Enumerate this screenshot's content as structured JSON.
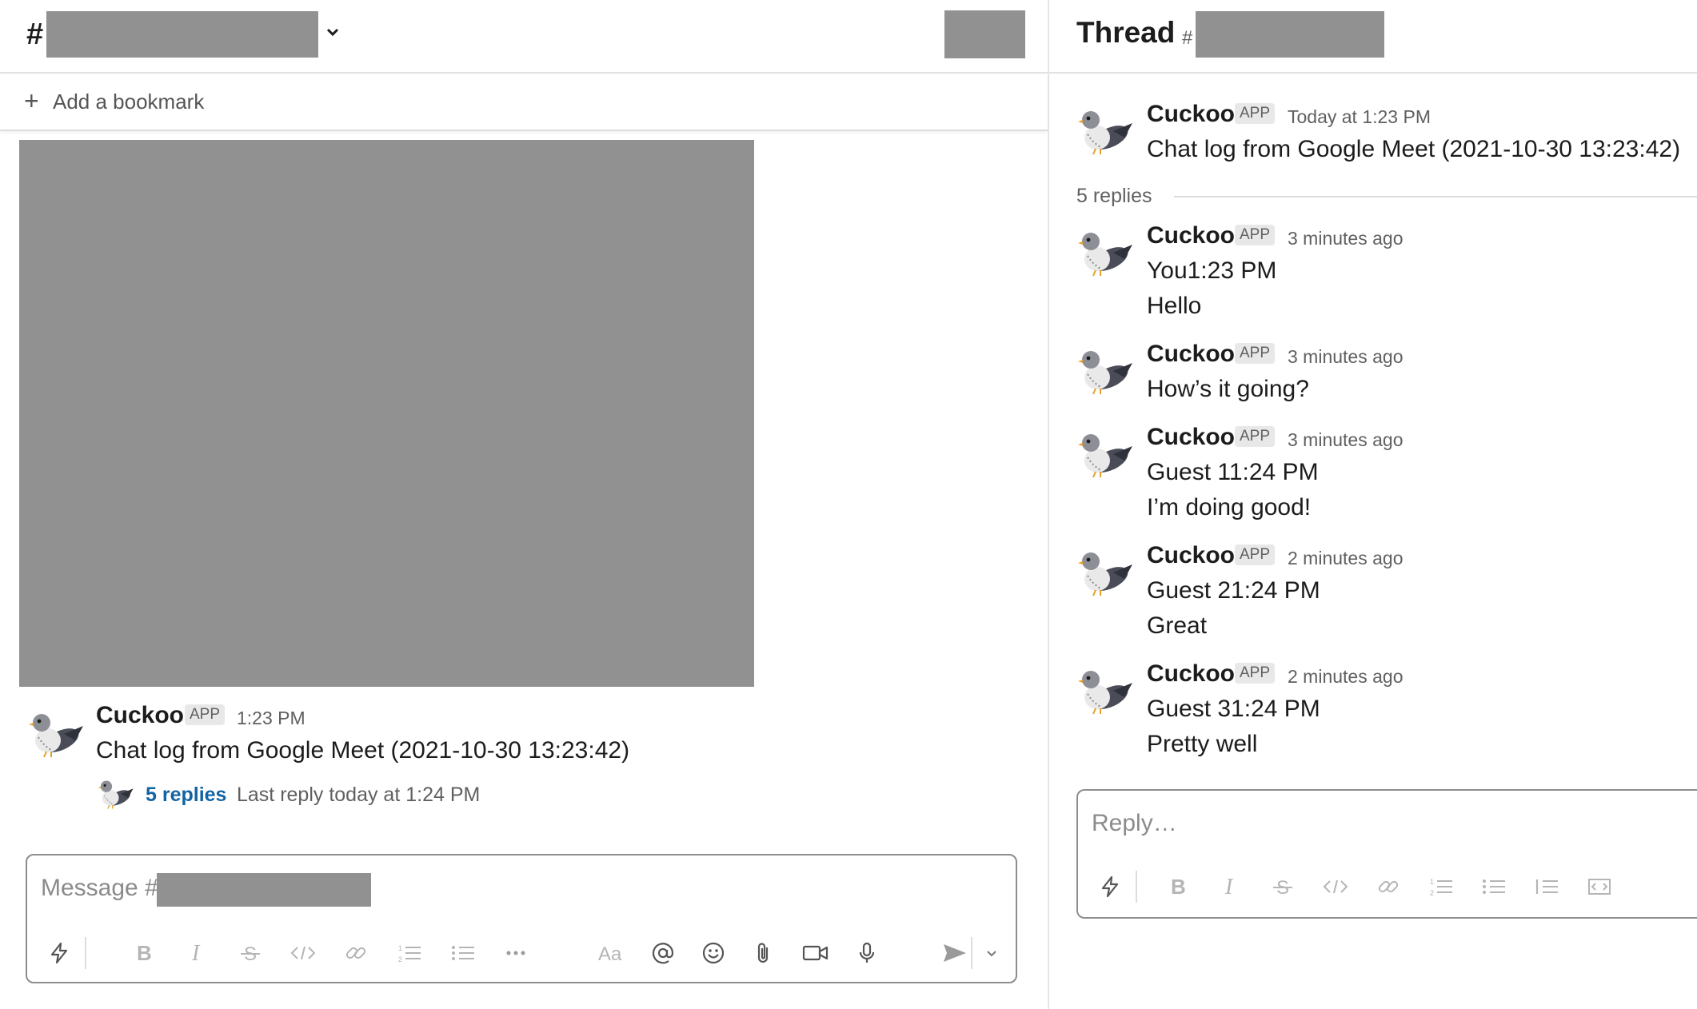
{
  "channel": {
    "hash": "#",
    "bookmark_label": "Add a bookmark",
    "message": {
      "author": "Cuckoo",
      "badge": "APP",
      "time": "1:23 PM",
      "text": "Chat log from Google Meet (2021-10-30 13:23:42)",
      "replies_link": "5 replies",
      "last_reply": "Last reply today at 1:24 PM"
    },
    "composer": {
      "placeholder": "Message #",
      "toolbar_icons": [
        "shortcuts-icon",
        "bold-icon",
        "italic-icon",
        "strikethrough-icon",
        "code-icon",
        "link-icon",
        "ordered-list-icon",
        "bulleted-list-icon",
        "more-icon",
        "formatting-icon",
        "mention-icon",
        "emoji-icon",
        "attach-icon",
        "video-icon",
        "microphone-icon",
        "send-icon",
        "send-options-chevron-icon"
      ]
    }
  },
  "thread": {
    "title": "Thread",
    "hash": "#",
    "parent": {
      "author": "Cuckoo",
      "badge": "APP",
      "time": "Today at 1:23 PM",
      "text": "Chat log from Google Meet (2021-10-30 13:23:42)"
    },
    "replies_count": "5 replies",
    "replies": [
      {
        "author": "Cuckoo",
        "badge": "APP",
        "time": "3 minutes ago",
        "lines": [
          "You1:23 PM",
          "Hello"
        ]
      },
      {
        "author": "Cuckoo",
        "badge": "APP",
        "time": "3 minutes ago",
        "lines": [
          "How’s it going?"
        ]
      },
      {
        "author": "Cuckoo",
        "badge": "APP",
        "time": "3 minutes ago",
        "lines": [
          "Guest 11:24 PM",
          "I’m doing good!"
        ]
      },
      {
        "author": "Cuckoo",
        "badge": "APP",
        "time": "2 minutes ago",
        "lines": [
          "Guest 21:24 PM",
          "Great"
        ]
      },
      {
        "author": "Cuckoo",
        "badge": "APP",
        "time": "2 minutes ago",
        "lines": [
          "Guest 31:24 PM",
          "Pretty well"
        ]
      }
    ],
    "reply_placeholder": "Reply…"
  },
  "colors": {
    "link": "#1264a3",
    "redaction": "#919191",
    "muted_text": "#616061",
    "icon_gray": "#9a9a9a"
  }
}
